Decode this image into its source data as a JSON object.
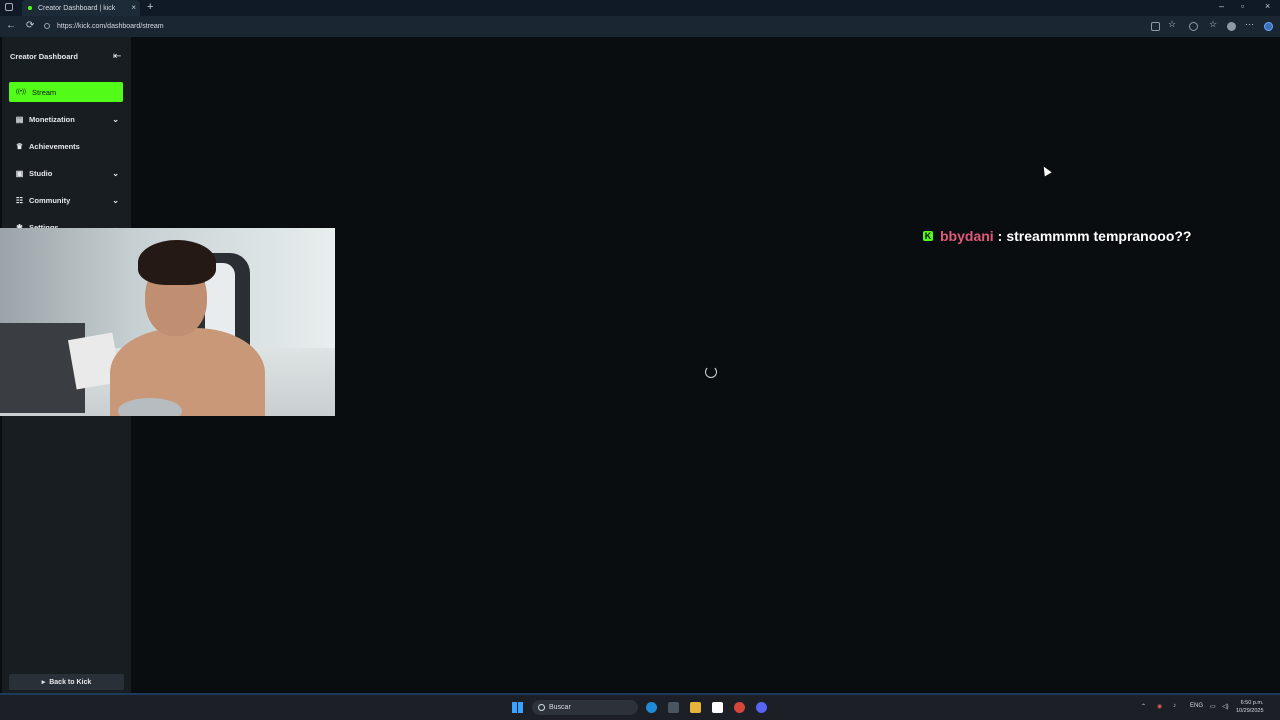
{
  "browser": {
    "tab_title": "Creator Dashboard | kick",
    "tab_close": "×",
    "new_tab": "+",
    "url": "https://kick.com/dashboard/stream",
    "window_controls": [
      "–",
      "▫",
      "×"
    ]
  },
  "sidebar": {
    "title": "Creator Dashboard",
    "items": [
      {
        "label": "Stream",
        "icon": "broadcast-icon",
        "glyph": "((•))",
        "active": true
      },
      {
        "label": "Monetization",
        "icon": "chart-icon",
        "glyph": "▤",
        "chevron": true
      },
      {
        "label": "Achievements",
        "icon": "trophy-icon",
        "glyph": "♛"
      },
      {
        "label": "Studio",
        "icon": "studio-icon",
        "glyph": "▣",
        "chevron": true
      },
      {
        "label": "Community",
        "icon": "community-icon",
        "glyph": "☷",
        "chevron": true
      },
      {
        "label": "Settings",
        "icon": "gear-icon",
        "glyph": "✱",
        "chevron": true
      }
    ],
    "back_button": "Back to Kick"
  },
  "chat_overlay": {
    "username": "bbydani",
    "separator": ":",
    "message": "streammmm tempranooo??"
  },
  "taskbar": {
    "search_placeholder": "Buscar",
    "language": "ENG",
    "time": "6:50 p.m.",
    "date": "10/29/2025"
  },
  "colors": {
    "accent": "#53fc18",
    "username": "#e05a7a",
    "background": "#0a0d0f",
    "sidebar": "#181d22"
  }
}
